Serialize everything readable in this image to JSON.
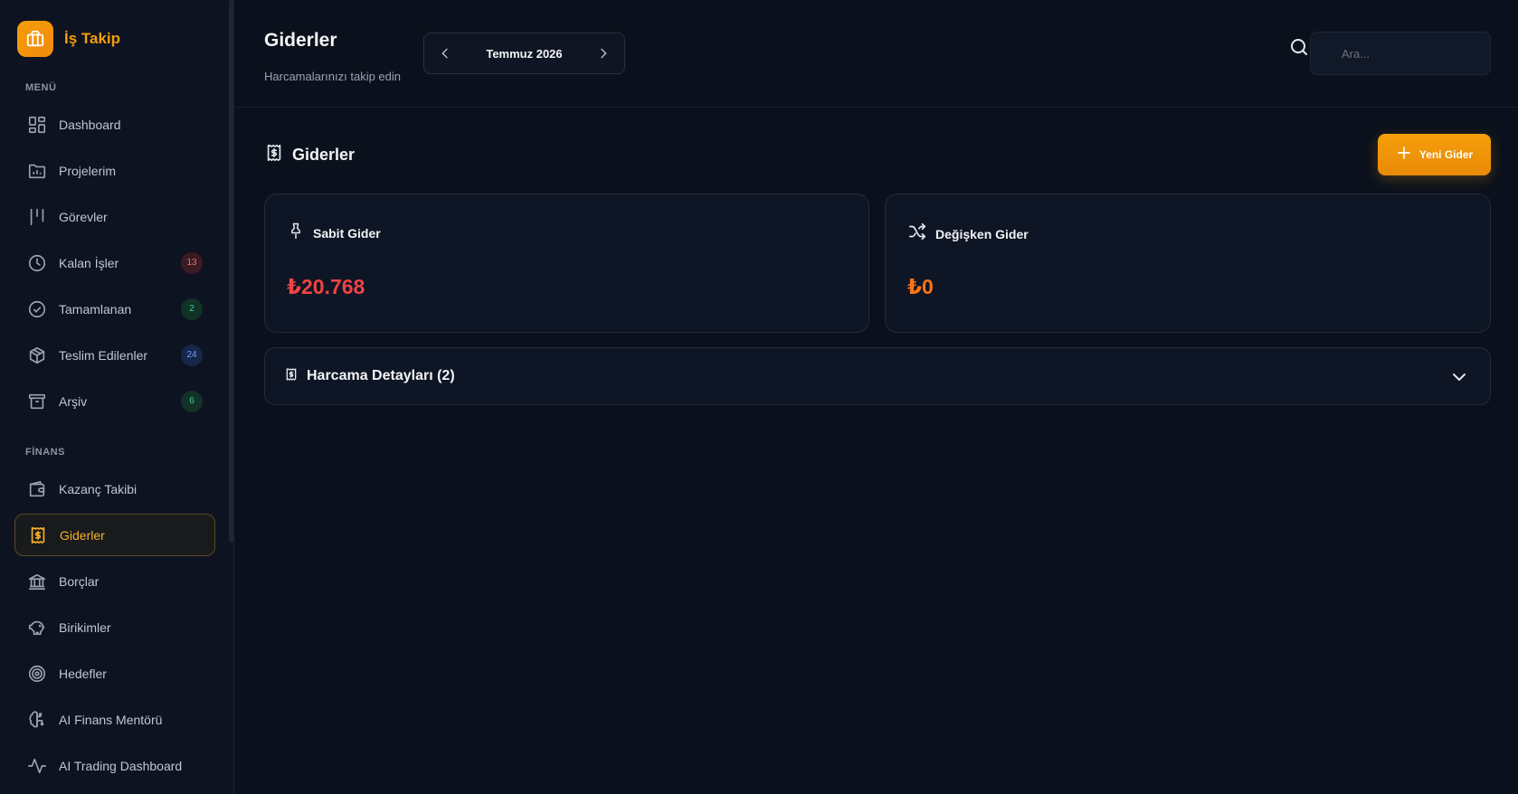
{
  "brand": {
    "name": "İş Takip",
    "logo_icon": "briefcase-icon",
    "accent": "#f59e0b"
  },
  "sidebar": {
    "menu_label": "MENÜ",
    "menu_items": [
      {
        "label": "Dashboard",
        "icon": "dashboard-icon"
      },
      {
        "label": "Projelerim",
        "icon": "folder-icon"
      },
      {
        "label": "Görevler",
        "icon": "kanban-icon"
      },
      {
        "label": "Kalan İşler",
        "icon": "clock-icon",
        "badge": "13",
        "badge_color": "#f07178"
      },
      {
        "label": "Tamamlanan",
        "icon": "check-circle-icon",
        "badge": "2",
        "badge_color": "#34d399"
      },
      {
        "label": "Teslim Edilenler",
        "icon": "package-icon",
        "badge": "24",
        "badge_color": "#6ea3ff"
      },
      {
        "label": "Arşiv",
        "icon": "archive-icon",
        "badge": "6",
        "badge_color": "#34d399"
      }
    ],
    "finance_label": "FİNANS",
    "finance_items": [
      {
        "label": "Kazanç Takibi",
        "icon": "wallet-icon"
      },
      {
        "label": "Giderler",
        "icon": "receipt-icon",
        "active": true
      },
      {
        "label": "Borçlar",
        "icon": "bank-icon"
      },
      {
        "label": "Birikimler",
        "icon": "piggy-bank-icon"
      },
      {
        "label": "Hedefler",
        "icon": "target-icon"
      },
      {
        "label": "AI Finans Mentörü",
        "icon": "brain-icon"
      },
      {
        "label": "AI Trading Dashboard",
        "icon": "activity-icon"
      }
    ]
  },
  "header": {
    "title": "Giderler",
    "subtitle": "Harcamalarınızı takip edin",
    "month": "Temmuz 2026",
    "search_placeholder": "Ara..."
  },
  "main": {
    "section_title": "Giderler",
    "new_button": "Yeni Gider",
    "cards": [
      {
        "label": "Sabit Gider",
        "icon": "pin-icon",
        "value": "₺20.768",
        "color": "#ef4444"
      },
      {
        "label": "Değişken Gider",
        "icon": "shuffle-icon",
        "value": "₺0",
        "color": "#f97316"
      }
    ],
    "details_label": "Harcama Detayları (2)"
  }
}
